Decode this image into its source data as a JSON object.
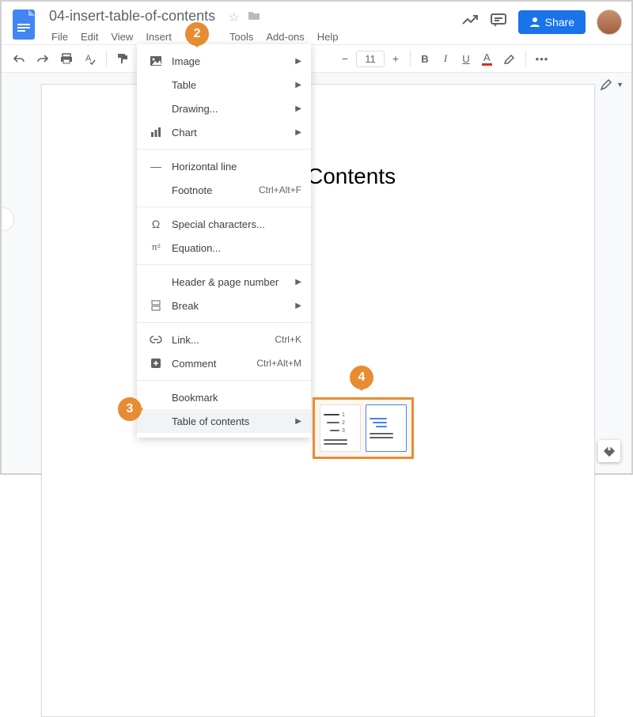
{
  "header": {
    "doc_title": "04-insert-table-of-contents",
    "menus": {
      "file": "File",
      "edit": "Edit",
      "view": "View",
      "insert": "Insert",
      "tools": "Tools",
      "addons": "Add-ons",
      "help": "Help"
    },
    "share": "Share"
  },
  "toolbar": {
    "font_size": "11"
  },
  "content": {
    "heading": "Contents"
  },
  "insert_menu": {
    "image": "Image",
    "table": "Table",
    "drawing": "Drawing...",
    "chart": "Chart",
    "hline": "Horizontal line",
    "footnote": "Footnote",
    "footnote_sc": "Ctrl+Alt+F",
    "special": "Special characters...",
    "equation": "Equation...",
    "header_pg": "Header & page number",
    "break": "Break",
    "link": "Link...",
    "link_sc": "Ctrl+K",
    "comment": "Comment",
    "comment_sc": "Ctrl+Alt+M",
    "bookmark": "Bookmark",
    "toc": "Table of contents"
  },
  "callouts": {
    "c2": "2",
    "c3": "3",
    "c4": "4"
  }
}
